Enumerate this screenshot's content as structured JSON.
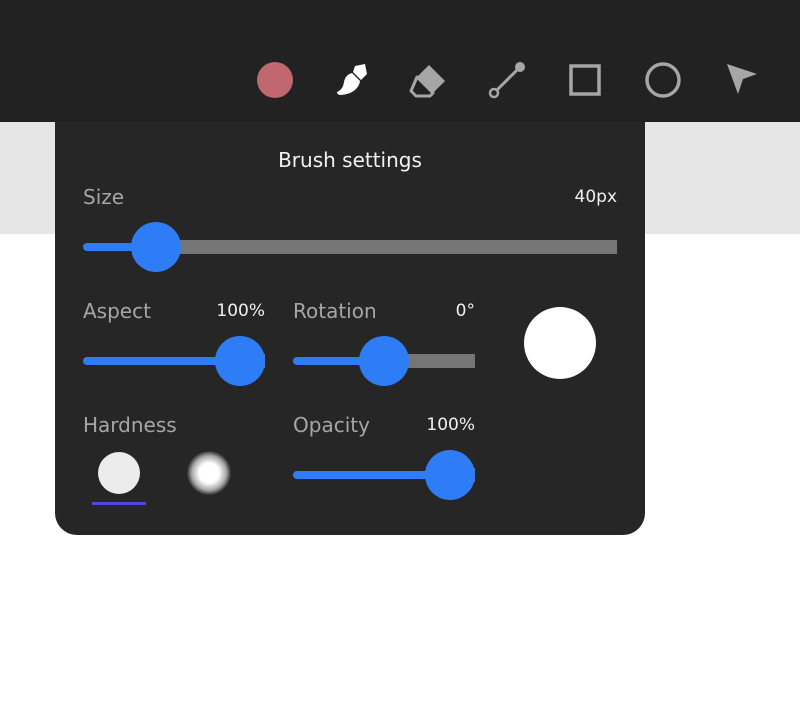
{
  "toolbar": {
    "color_swatch": "#c0676f",
    "icon_color": "#a6a6a6",
    "active_icon_color": "#ffffff",
    "tools": [
      {
        "name": "color-swatch",
        "icon": "filled-circle"
      },
      {
        "name": "brush",
        "icon": "brush-icon",
        "active": true
      },
      {
        "name": "eraser",
        "icon": "eraser-icon"
      },
      {
        "name": "line",
        "icon": "line-icon"
      },
      {
        "name": "rectangle",
        "icon": "square-icon"
      },
      {
        "name": "ellipse",
        "icon": "circle-icon"
      },
      {
        "name": "select",
        "icon": "arrow-pointer-icon"
      }
    ]
  },
  "brush_settings": {
    "title": "Brush settings",
    "size": {
      "label": "Size",
      "value": "40px",
      "fraction": 0.1
    },
    "aspect": {
      "label": "Aspect",
      "value": "100%",
      "fraction": 1.0
    },
    "rotation": {
      "label": "Rotation",
      "value": "0°",
      "fraction": 0.5
    },
    "hardness": {
      "label": "Hardness",
      "options": [
        "hard",
        "soft"
      ],
      "selected": "hard"
    },
    "opacity": {
      "label": "Opacity",
      "value": "100%",
      "fraction": 1.0
    }
  },
  "colors": {
    "accent": "#2f7df6",
    "panel": "#262626",
    "toolbar": "#222222",
    "selection_underline": "#4a4adf"
  }
}
